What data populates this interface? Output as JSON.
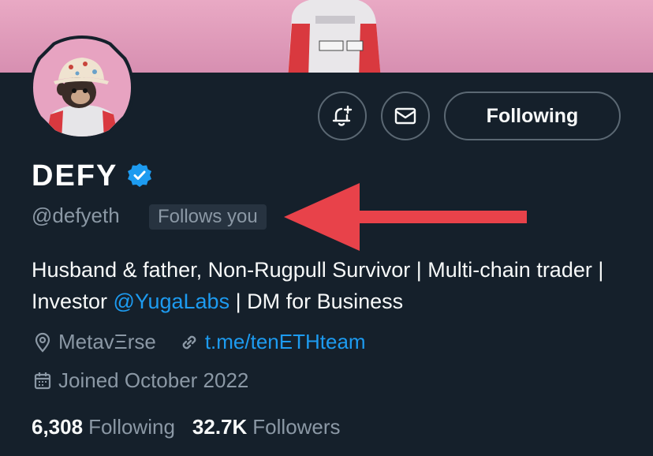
{
  "profile": {
    "display_name": "DEFY",
    "handle": "@defyeth",
    "follows_you": "Follows you",
    "bio_part1": "Husband & father, Non-Rugpull Survivor | Multi-chain trader | Investor ",
    "bio_mention": "@YugaLabs",
    "bio_part2": " | DM for Business",
    "location": "MetavΞrse",
    "website": "t.me/tenETHteam",
    "joined": "Joined October 2022",
    "following_count": "6,308",
    "following_label": "Following",
    "followers_count": "32.7K",
    "followers_label": "Followers"
  },
  "actions": {
    "notify_icon": "bell-plus-icon",
    "message_icon": "envelope-icon",
    "following_button": "Following"
  },
  "colors": {
    "background": "#15202b",
    "accent": "#1d9bf0",
    "muted": "#8b98a5",
    "banner": "#e9a9c4",
    "arrow": "#e8424a"
  }
}
